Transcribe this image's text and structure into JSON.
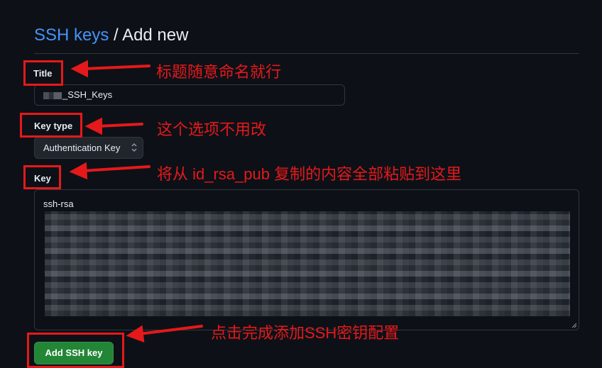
{
  "header": {
    "crumb": "SSH keys",
    "separator": "/",
    "current": "Add new"
  },
  "form": {
    "title_label": "Title",
    "title_value": "_SSH_Keys",
    "key_type_label": "Key type",
    "key_type_selected": "Authentication Key",
    "key_label": "Key",
    "key_value_visible": "ssh-rsa",
    "submit_label": "Add SSH key"
  },
  "annotations": {
    "title_note": "标题随意命名就行",
    "key_type_note": "这个选项不用改",
    "key_note": "将从 id_rsa_pub 复制的内容全部粘贴到这里",
    "submit_note": "点击完成添加SSH密钥配置",
    "color": "#e5191b"
  },
  "colors": {
    "background": "#0d1117",
    "link": "#4493f8",
    "button_green": "#238636",
    "border": "#30363d"
  }
}
